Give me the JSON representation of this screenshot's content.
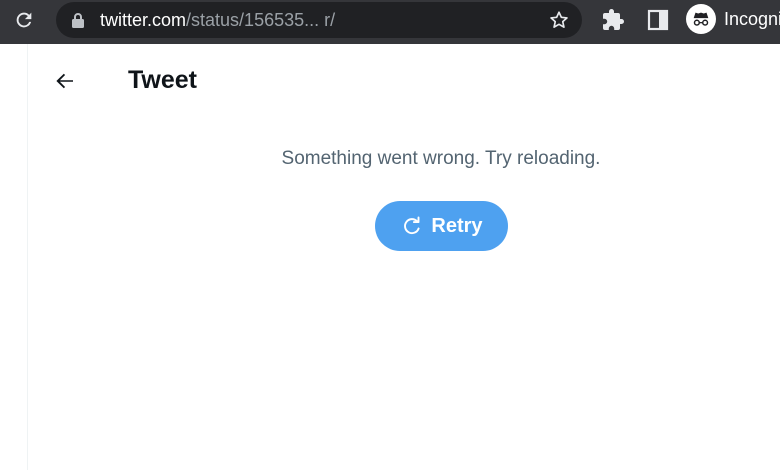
{
  "browser": {
    "url_host": "twitter.com",
    "url_path": "/status/156535... r/",
    "profile_label": "Incognito",
    "icons": [
      "reload-icon",
      "lock-icon",
      "star-icon",
      "puzzle-icon",
      "side-panel-icon",
      "incognito-icon"
    ],
    "colors": {
      "toolbar": "#35363a",
      "omnibox": "#202124"
    }
  },
  "page": {
    "title": "Tweet",
    "back_icon": "arrow-left-icon",
    "error_message": "Something went wrong. Try reloading.",
    "retry_label": "Retry",
    "retry_icon": "refresh-icon",
    "colors": {
      "accent": "#4ea1f0",
      "muted_text": "#536471",
      "title_text": "#0f1419"
    }
  }
}
